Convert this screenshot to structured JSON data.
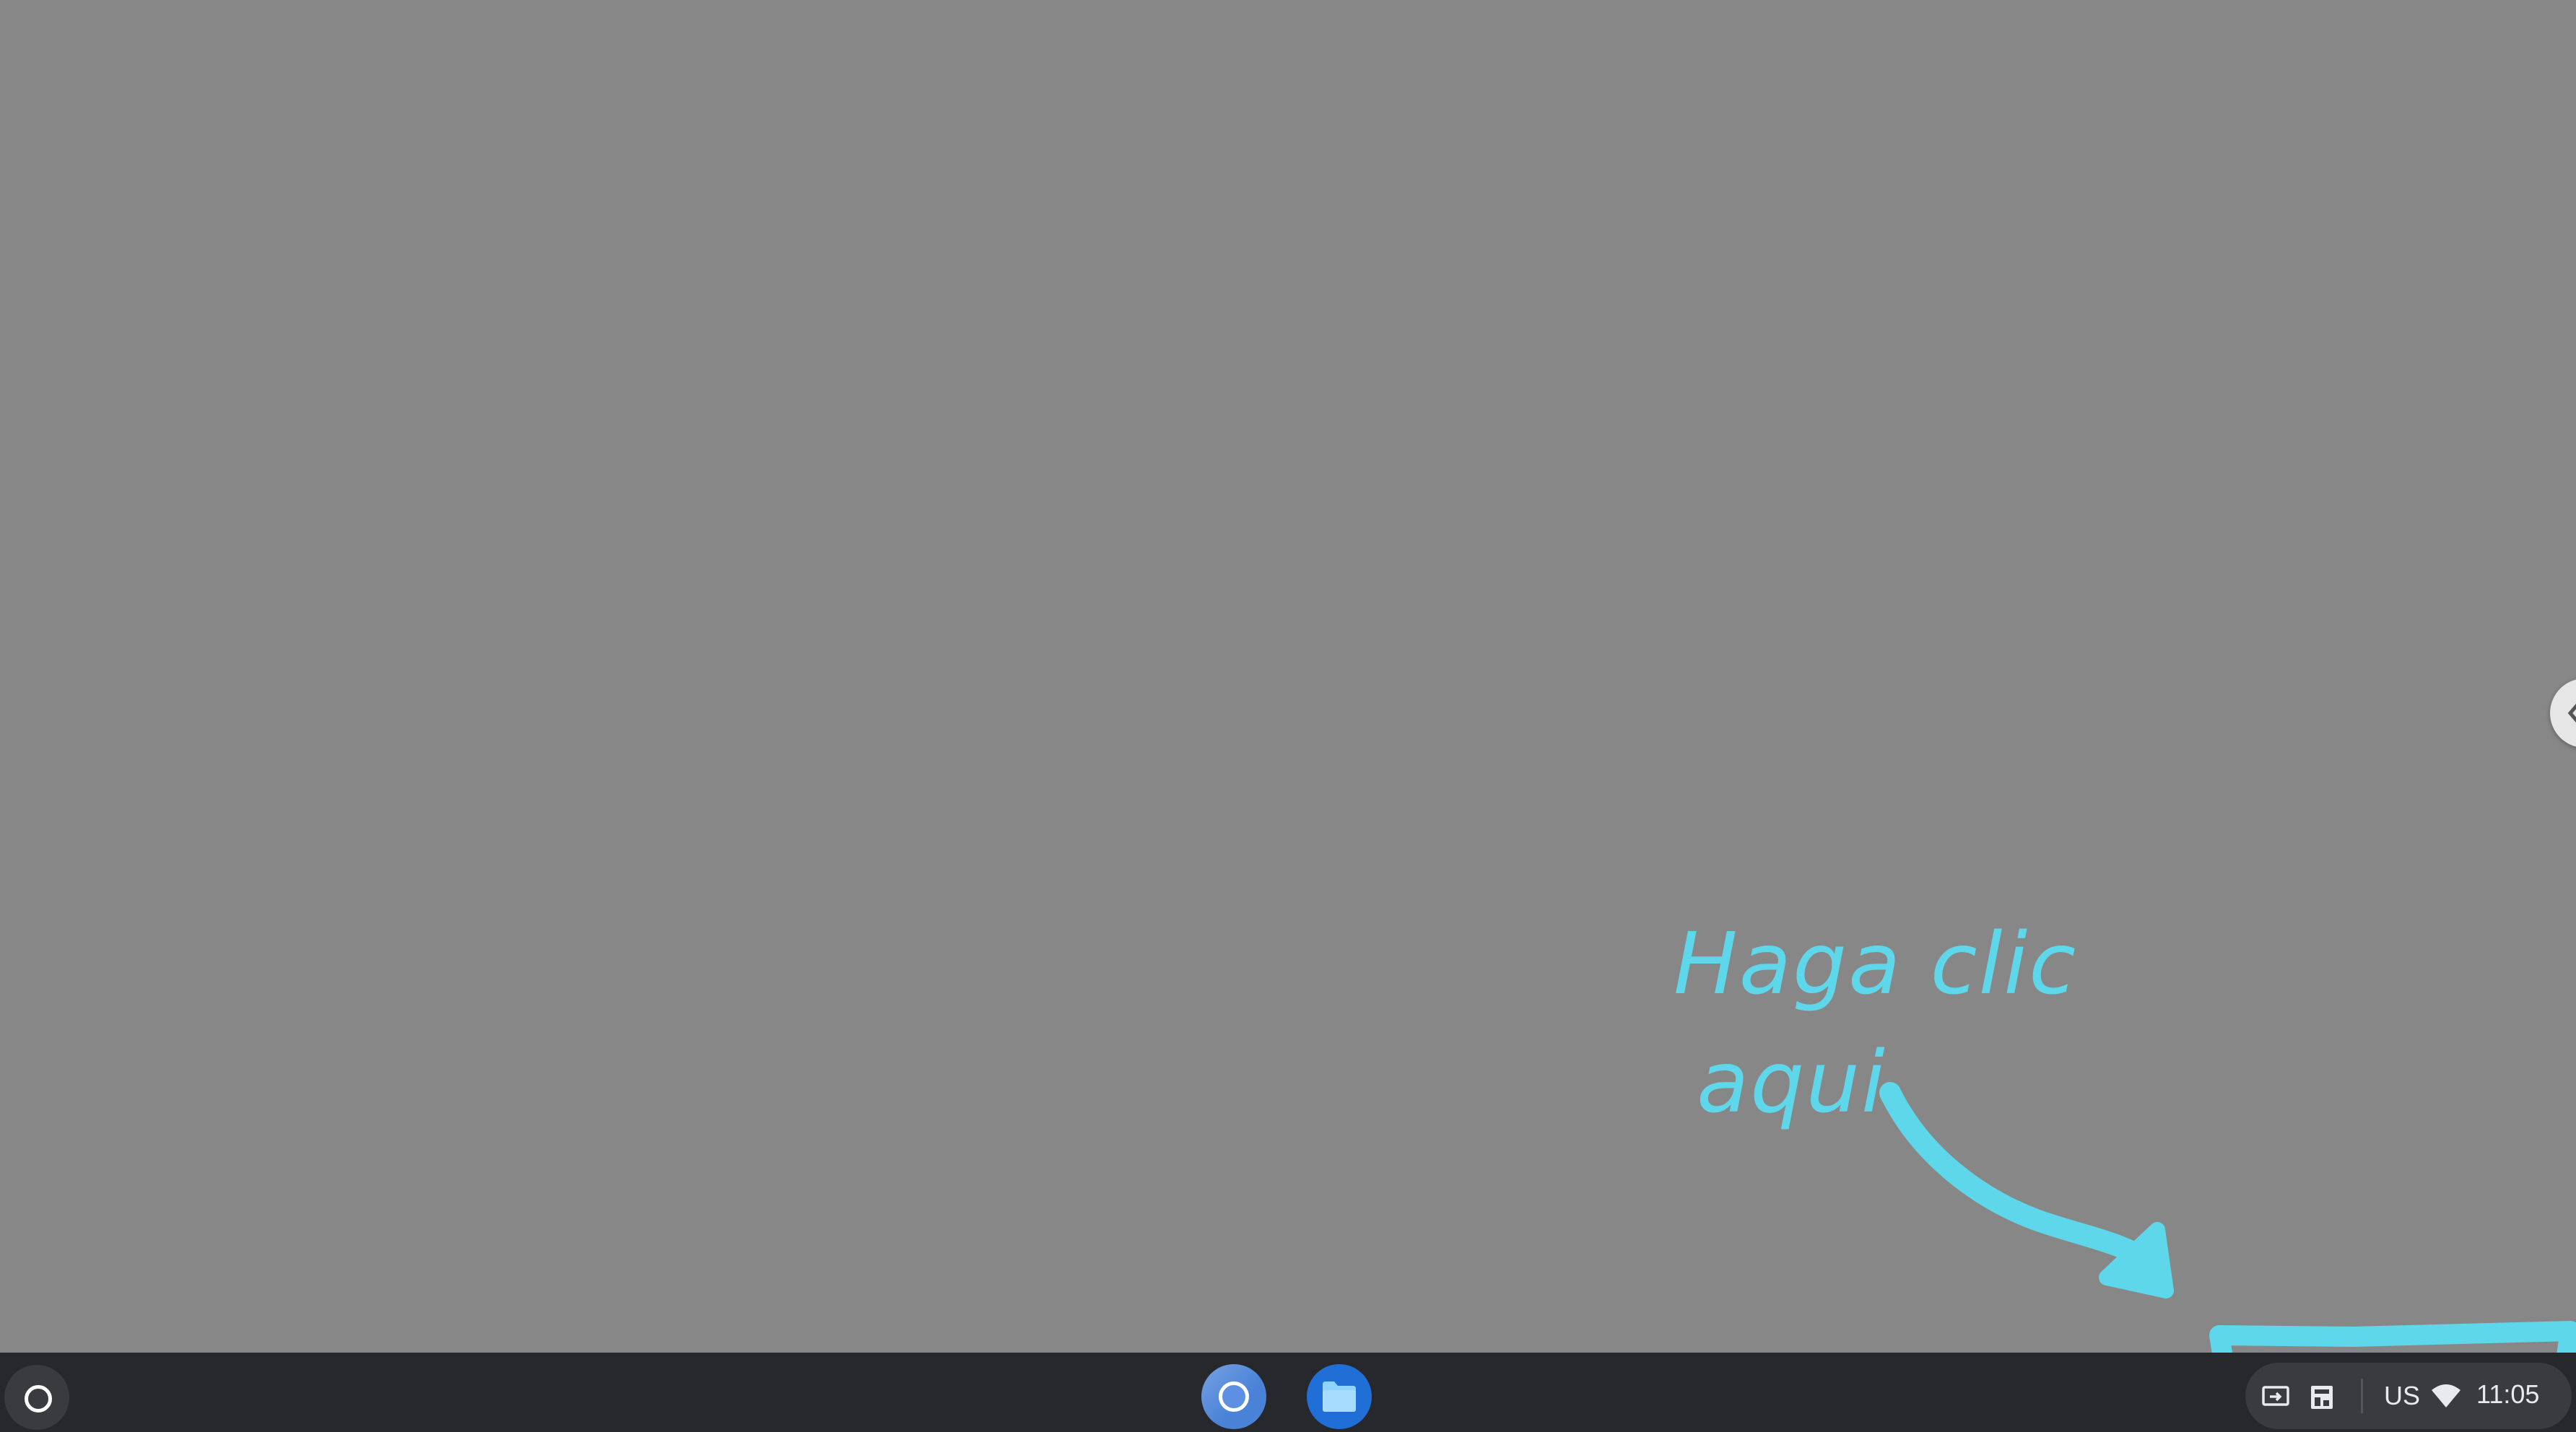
{
  "annotation": {
    "line1": "Haga clic",
    "line2": "aqui",
    "color": "#5fd7ea"
  },
  "shelf": {
    "launcher_icon": "launcher-circle-icon",
    "apps": [
      {
        "name": "Chrome",
        "icon": "chrome-icon"
      },
      {
        "name": "Files",
        "icon": "folder-icon"
      }
    ],
    "status_tray": {
      "icons": [
        "screen-capture-icon",
        "tray-app-icon",
        "wifi-icon"
      ],
      "ime": "US",
      "time": "11:05"
    }
  },
  "colors": {
    "desktop_background": "#878787",
    "shelf_background": "#27282b",
    "files_blue": "#1f6fd6",
    "chrome_blue": "#4a82d8"
  }
}
